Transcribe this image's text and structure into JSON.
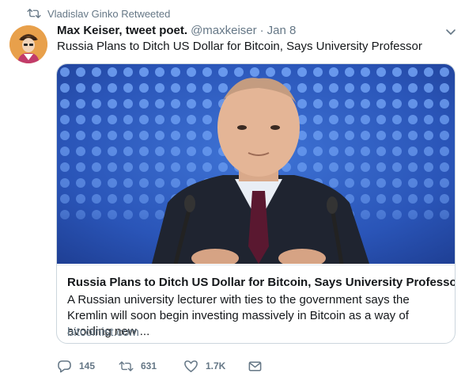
{
  "retweet_context": {
    "label": "Vladislav Ginko Retweeted"
  },
  "author": {
    "display_name": "Max Keiser, tweet poet.",
    "handle": "@maxkeiser",
    "separator": "·",
    "date": "Jan 8"
  },
  "tweet": {
    "text": "Russia Plans to Ditch US Dollar for Bitcoin, Says University Professor"
  },
  "card": {
    "title": "Russia Plans to Ditch US Dollar for Bitcoin, Says University Professor...",
    "description": "A Russian university lecturer with ties to the government says the Kremlin will soon begin investing massively in Bitcoin as a way of avoiding new ...",
    "domain": "bitcoinist.com"
  },
  "actions": {
    "replies": "145",
    "retweets": "631",
    "likes": "1.7K"
  },
  "colors": {
    "secondary_text": "#657786",
    "border": "#ccd6dd",
    "backdrop_blue": "#2f5fc2"
  },
  "icons": [
    "retweet-icon",
    "chevron-down-icon",
    "reply-icon",
    "like-icon",
    "direct-message-icon"
  ]
}
